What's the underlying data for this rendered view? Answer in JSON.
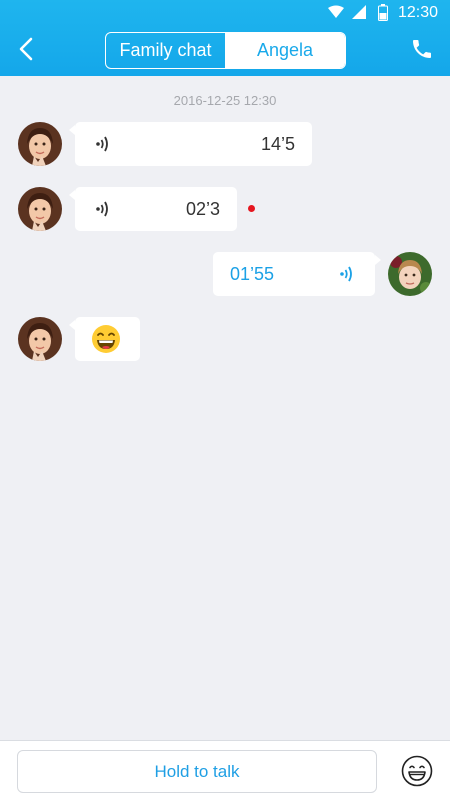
{
  "status_bar": {
    "time": "12:30",
    "icons": [
      "wifi-icon",
      "signal-icon",
      "battery-icon"
    ]
  },
  "header": {
    "back_icon": "chevron-left-icon",
    "tabs": [
      {
        "label": "Family chat",
        "active": true
      },
      {
        "label": "Angela",
        "active": false
      }
    ],
    "call_icon": "phone-icon"
  },
  "chat": {
    "timestamp": "2016-12-25 12:30",
    "messages": [
      {
        "side": "left",
        "type": "voice",
        "duration": "14’5",
        "unread": false
      },
      {
        "side": "left",
        "type": "voice",
        "duration": "02’3",
        "unread": true
      },
      {
        "side": "right",
        "type": "voice",
        "duration": "01’55"
      },
      {
        "side": "left",
        "type": "emoji",
        "emoji": "grinning-face"
      }
    ]
  },
  "bottom_bar": {
    "hold_label": "Hold to talk",
    "emoji_icon": "smiley-icon"
  },
  "colors": {
    "header": "#19acea",
    "accent": "#1ba1e6",
    "unread": "#e5161f",
    "background": "#eff0f4"
  }
}
